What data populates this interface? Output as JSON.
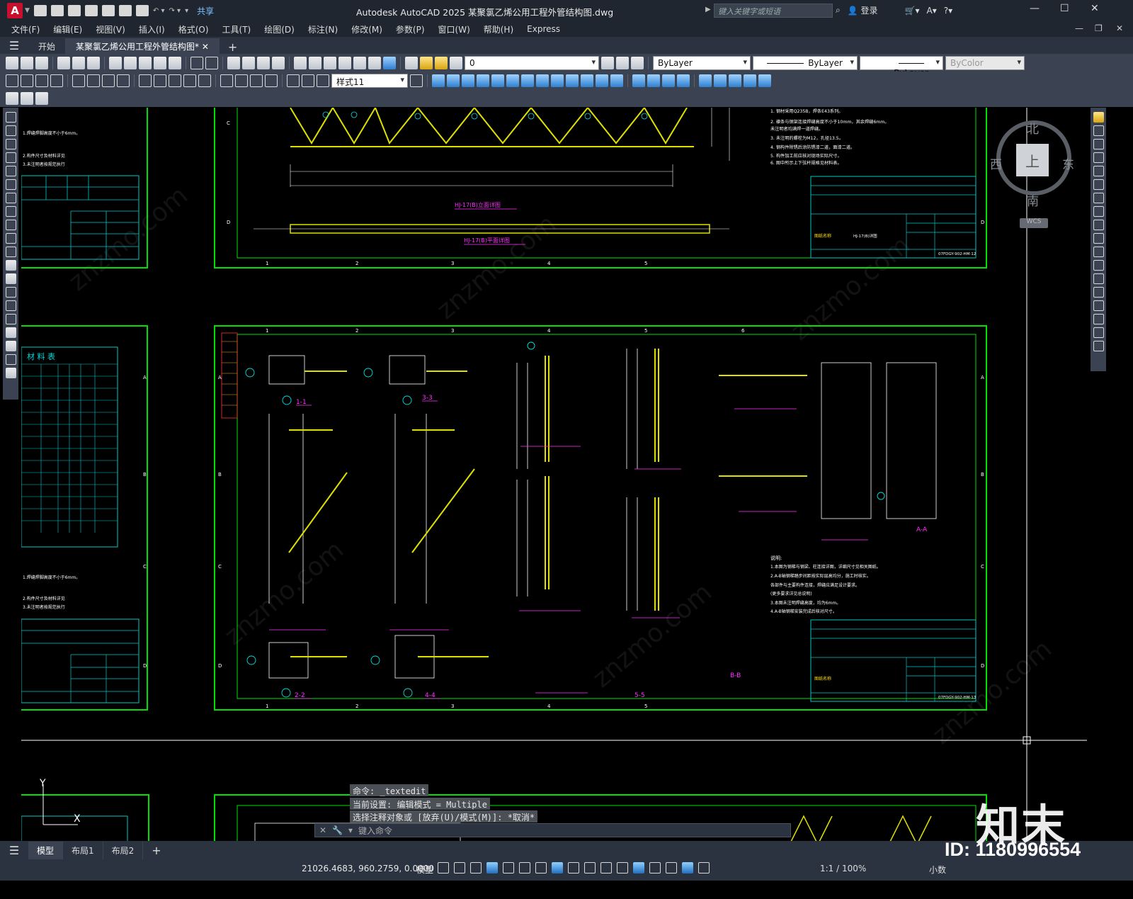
{
  "app": {
    "title": "Autodesk AutoCAD 2025    某聚氯乙烯公用工程外管结构图.dwg",
    "logo": "A",
    "share": "共享",
    "search_placeholder": "键入关键字或短语",
    "login": "登录"
  },
  "menu": [
    "文件(F)",
    "编辑(E)",
    "视图(V)",
    "插入(I)",
    "格式(O)",
    "工具(T)",
    "绘图(D)",
    "标注(N)",
    "修改(M)",
    "参数(P)",
    "窗口(W)",
    "帮助(H)",
    "Express"
  ],
  "tabs": {
    "start": "开始",
    "active": "某聚氯乙烯公用工程外管结构图*"
  },
  "properties": {
    "layer": "0",
    "color": "ByLayer",
    "linetype": "ByLayer",
    "lineweight": "ByLayer",
    "plotstyle": "ByColor",
    "dimstyle": "样式11"
  },
  "viewcube": {
    "north": "北",
    "south": "南",
    "east": "东",
    "west": "西",
    "top": "上",
    "wcs": "WCS"
  },
  "ucs": {
    "y": "Y",
    "x": "X"
  },
  "command": {
    "history": [
      "命令: _textedit",
      "当前设置: 编辑模式 = Multiple",
      "选择注释对象或 [放弃(U)/模式(M)]: *取消*"
    ],
    "placeholder": "键入命令"
  },
  "layout_tabs": [
    "模型",
    "布局1",
    "布局2"
  ],
  "status": {
    "coords": "21026.4683, 960.2759, 0.0000",
    "space": "模型",
    "annotation_scale": "1:1 / 100%",
    "units": "小数"
  },
  "drawing": {
    "title_hj": "HJ-17(B)立面详图",
    "title_plan": "HJ-17(B)平面详图",
    "section_labels": [
      "1-1",
      "3-3",
      "2-2",
      "4-4",
      "5-5",
      "A-A",
      "B-B"
    ],
    "table_title": "材 料 表",
    "notes_title": "说明:"
  },
  "watermark": {
    "logo": "知末",
    "id": "ID: 1180996554"
  }
}
